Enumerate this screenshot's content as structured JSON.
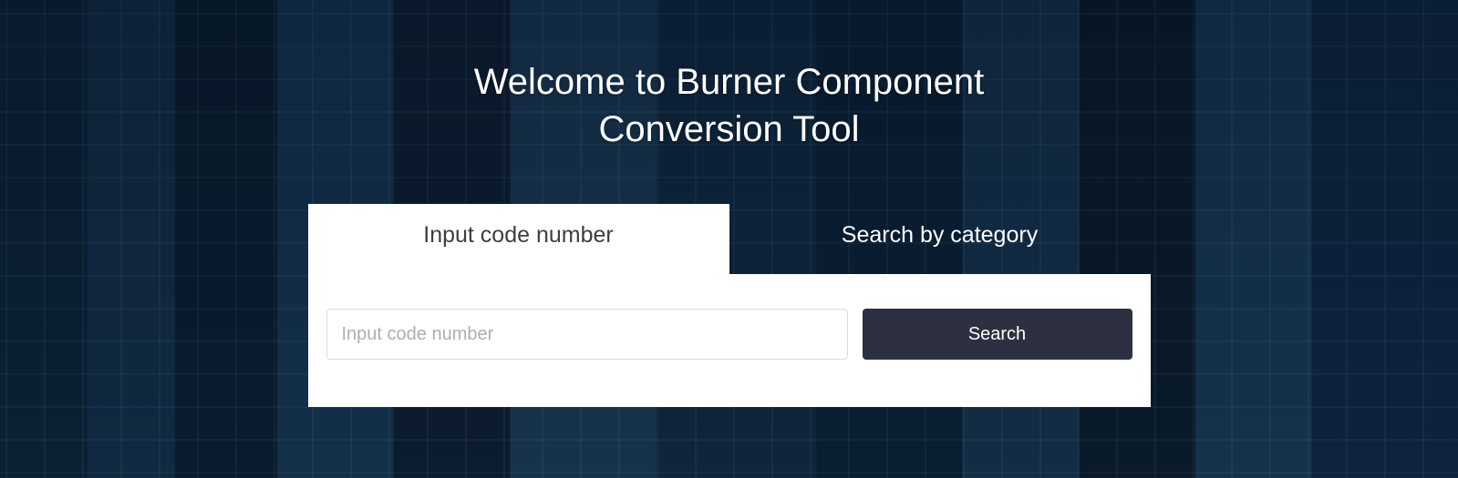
{
  "page_title": "Welcome to Burner Component Conversion Tool",
  "tabs": [
    {
      "label": "Input code number",
      "active": true
    },
    {
      "label": "Search by category",
      "active": false
    }
  ],
  "search": {
    "input_placeholder": "Input code number",
    "input_value": "",
    "button_label": "Search"
  }
}
